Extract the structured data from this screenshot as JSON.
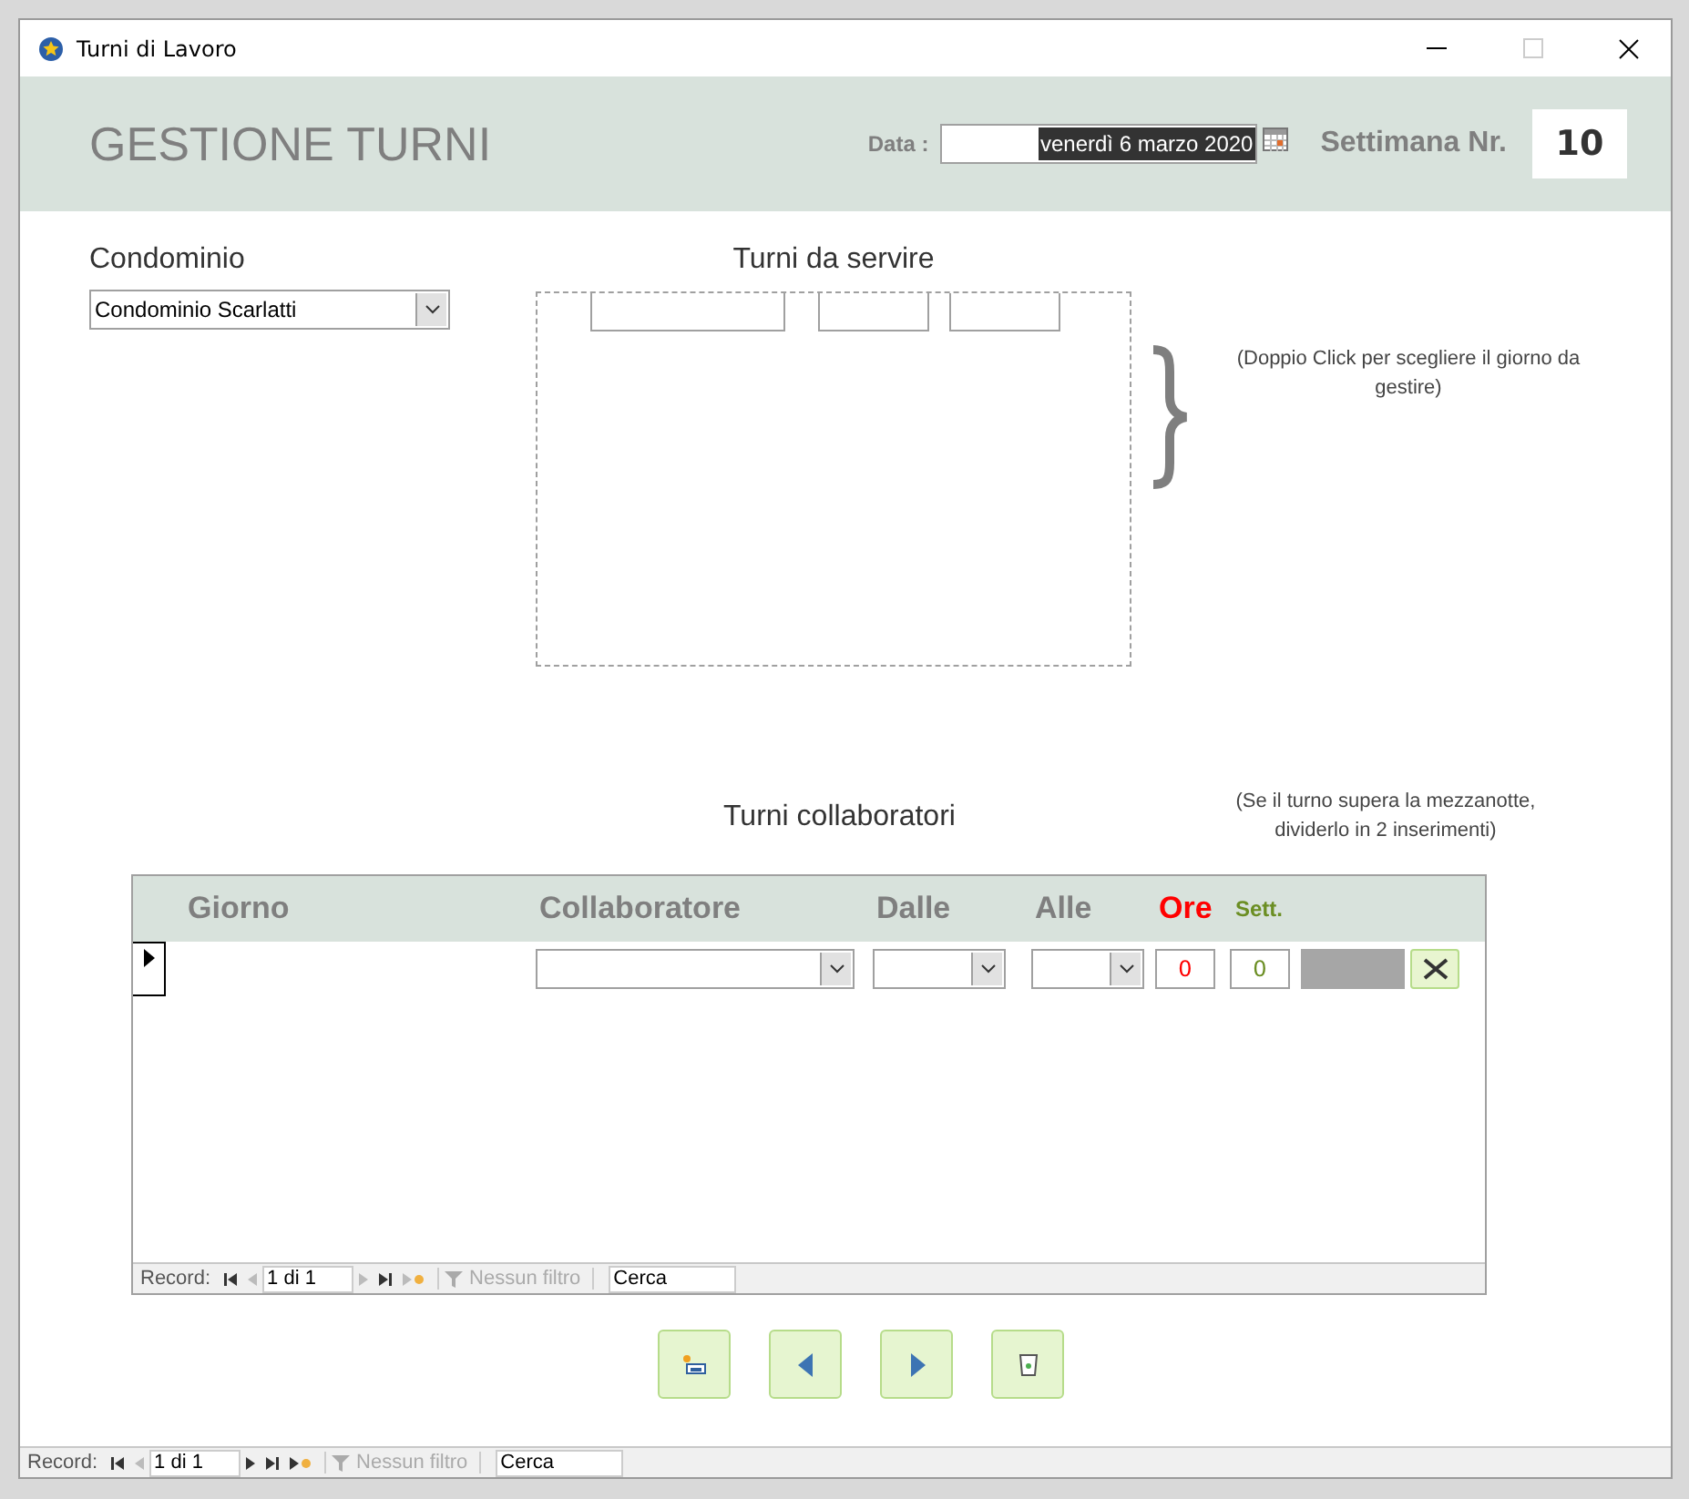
{
  "window": {
    "title": "Turni di Lavoro"
  },
  "header": {
    "title": "GESTIONE TURNI",
    "date_label": "Data :",
    "date_value": "venerdì 6 marzo 2020",
    "week_label": "Settimana Nr.",
    "week_value": "10"
  },
  "condominio": {
    "label": "Condominio",
    "value": "Condominio Scarlatti"
  },
  "turni_da_servire": {
    "title": "Turni da servire",
    "hint": "(Doppio Click per scegliere il giorno da gestire)"
  },
  "turni_collaboratori": {
    "title": "Turni collaboratori",
    "hint": "(Se il turno supera la mezzanotte, dividerlo in 2 inserimenti)",
    "columns": [
      {
        "label": "Giorno",
        "color": "#7f7f7f"
      },
      {
        "label": "Collaboratore",
        "color": "#7f7f7f"
      },
      {
        "label": "Dalle",
        "color": "#7f7f7f"
      },
      {
        "label": "Alle",
        "color": "#7f7f7f"
      },
      {
        "label": "Ore",
        "color": "#ff0000"
      },
      {
        "label": "Sett.",
        "color": "#6b8e23"
      }
    ],
    "row": {
      "ore": "0",
      "sett": "0"
    },
    "navigation": {
      "label": "Record:",
      "position": "1 di 1",
      "filter": "Nessun filtro",
      "filter_disabled": true,
      "search": "Cerca"
    }
  },
  "buttons": [
    {
      "kind": "new"
    },
    {
      "kind": "prev"
    },
    {
      "kind": "next"
    },
    {
      "kind": "delete"
    }
  ],
  "navigation": {
    "label": "Record:",
    "position": "1 di 1",
    "filter": "Nessun filtro",
    "filter_disabled": true,
    "search": "Cerca"
  }
}
